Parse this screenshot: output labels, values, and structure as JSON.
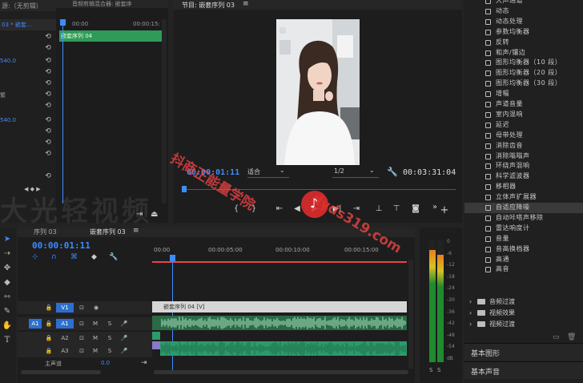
{
  "source_panel": {
    "header_left": "源:（无剪辑）",
    "header_tab": "音频剪辑混合器: 嵌套序",
    "subheader_left": "03 * 嵌套...",
    "timecode_header": "00:00",
    "timecode_header_2": "00:00:15:",
    "clip_bar_label": "嵌套序列 04",
    "values": [
      "540.0",
      "540.0"
    ],
    "value_labels": [
      "繁"
    ]
  },
  "program_monitor": {
    "title": "节目: 嵌套序列 03",
    "menu_icon": "menu-icon",
    "current_time": "00:00:01:11",
    "fit_label": "适合",
    "quality_label": "1/2",
    "duration": "00:03:31:04",
    "controls": [
      "mark-in-icon",
      "mark-out-icon",
      "go-to-in-icon",
      "step-back-icon",
      "play-icon",
      "step-forward-icon",
      "go-to-out-icon",
      "lift-icon",
      "extract-icon",
      "export-frame-icon",
      "add-icon"
    ]
  },
  "effects_list": {
    "items": [
      "大声通道",
      "动态",
      "动态处理",
      "参数均衡器",
      "反转",
      "和声/镶边",
      "图形均衡器（10 段）",
      "图形均衡器（20 段）",
      "图形均衡器（30 段）",
      "增幅",
      "声道音量",
      "室内混响",
      "延迟",
      "母带处理",
      "消除齿音",
      "消除嗡嗡声",
      "环绕声混响",
      "科学滤波器",
      "移相器",
      "立体声扩展器",
      "自适应降噪",
      "自动咔嗒声移除",
      "雷达响度计",
      "音量",
      "音高换档器",
      "高通",
      "高音"
    ],
    "selected": "自适应降噪",
    "folders": [
      "音频过渡",
      "视频效果",
      "视频过渡"
    ],
    "bottom_panels": [
      "基本图形",
      "基本声音"
    ]
  },
  "timeline": {
    "tabs": [
      "序列 03",
      "嵌套序列 03"
    ],
    "timecode": "00:00:01:11",
    "ruler": [
      "00:00",
      "00:00:05:00",
      "00:00:10:00",
      "00:00:15:00"
    ],
    "tracks": [
      {
        "id": "V1",
        "label": "V1"
      },
      {
        "id": "A1",
        "label": "A1"
      },
      {
        "id": "A2",
        "label": "A2"
      },
      {
        "id": "A3",
        "label": "A3"
      }
    ],
    "src_patch": "A1",
    "track_btns": [
      "M",
      "S"
    ],
    "master": {
      "label": "主声道",
      "value": "0.0"
    },
    "video_clip": "嵌套序列 04 [V]"
  },
  "meters": {
    "scale": [
      "0",
      "-6",
      "-12",
      "-18",
      "-24",
      "-30",
      "-36",
      "-42",
      "-48",
      "-54",
      "dB"
    ],
    "solo": [
      "S",
      "S"
    ],
    "level_left": 0.92,
    "level_right": 0.88
  },
  "watermark": {
    "line1": "抖商正能量学院",
    "line2": "dyds319.com",
    "bg": "大光轻视频"
  },
  "colors": {
    "accent_blue": "#3d8cff",
    "playhead": "#3d8cff",
    "clip_green": "#2d9a6b",
    "clip_purple": "#8a79c7",
    "red": "#e84545"
  }
}
